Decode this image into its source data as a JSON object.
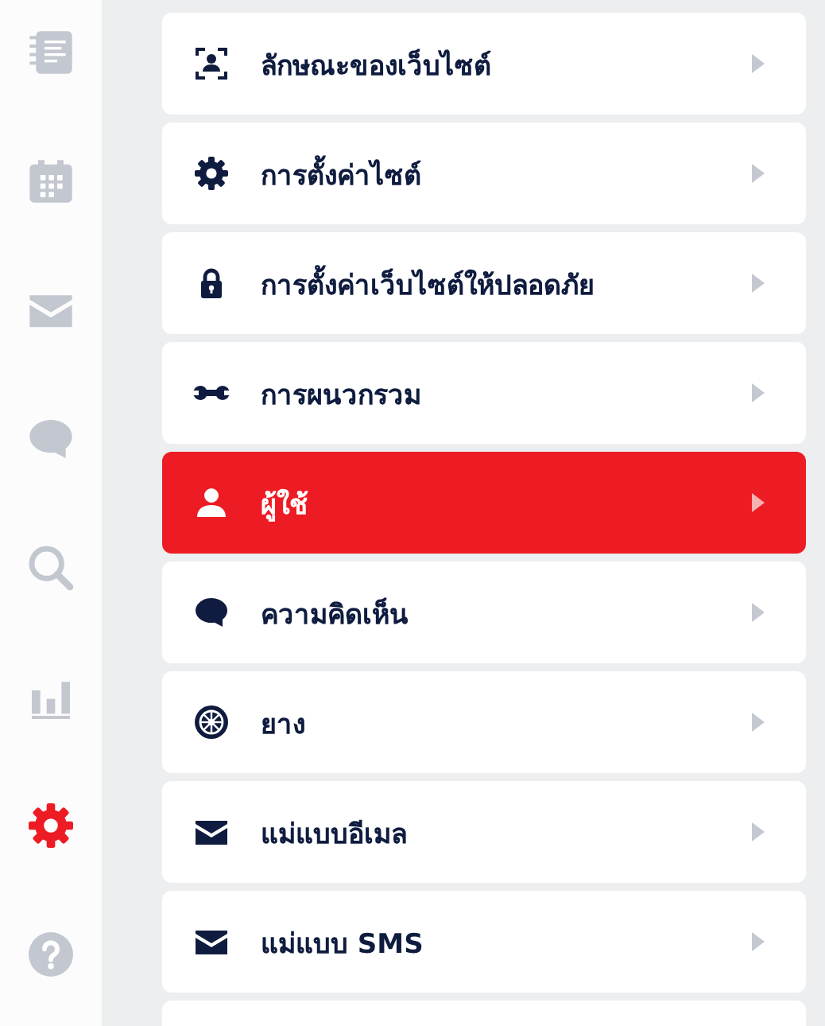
{
  "sidebar": {
    "items": [
      {
        "kind": "notebook",
        "selected": false
      },
      {
        "kind": "calendar",
        "selected": false
      },
      {
        "kind": "mail",
        "selected": false
      },
      {
        "kind": "chat",
        "selected": false
      },
      {
        "kind": "search",
        "selected": false
      },
      {
        "kind": "chart",
        "selected": false
      },
      {
        "kind": "gear",
        "selected": true
      },
      {
        "kind": "help",
        "selected": false
      }
    ]
  },
  "menu": {
    "items": [
      {
        "label": "ลักษณะของเว็บไซต์",
        "kind": "profile",
        "selected": false
      },
      {
        "label": "การตั้งค่าไซต์",
        "kind": "gear",
        "selected": false
      },
      {
        "label": "การตั้งค่าเว็บไซต์ให้ปลอดภัย",
        "kind": "lock",
        "selected": false
      },
      {
        "label": "การผนวกรวม",
        "kind": "wrench",
        "selected": false
      },
      {
        "label": "ผู้ใช้",
        "kind": "user",
        "selected": true
      },
      {
        "label": "ความคิดเห็น",
        "kind": "chat",
        "selected": false
      },
      {
        "label": "ยาง",
        "kind": "wheel",
        "selected": false
      },
      {
        "label": "แม่แบบอีเมล",
        "kind": "mail",
        "selected": false
      },
      {
        "label": "แม่แบบ SMS",
        "kind": "mail",
        "selected": false
      }
    ]
  }
}
